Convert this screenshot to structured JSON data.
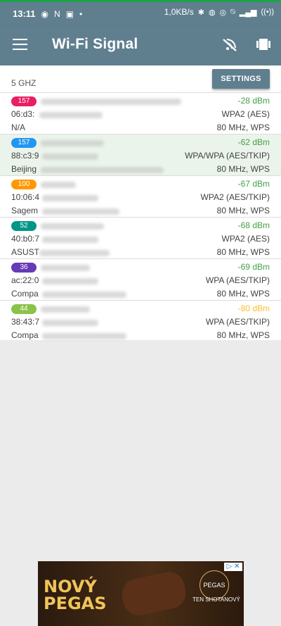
{
  "status_bar": {
    "time": "13:11",
    "net_speed": "1,0KB/s"
  },
  "app_bar": {
    "title": "Wi-Fi Signal"
  },
  "section": {
    "label": "5 GHZ",
    "settings_label": "SETTINGS"
  },
  "networks": [
    {
      "channel": "157",
      "channel_color": "#e91e63",
      "mac": "06:d3:",
      "vendor": "N/A",
      "dbm": "-28 dBm",
      "security": "WPA2 (AES)",
      "band": "80 MHz, WPS",
      "dbm_color": "#43a047"
    },
    {
      "channel": "157",
      "channel_color": "#2196f3",
      "mac": "88:c3:9",
      "vendor": "Beijing",
      "dbm": "-62 dBm",
      "security": "WPA/WPA (AES/TKIP)",
      "band": "80 MHz, WPS",
      "dbm_color": "#43a047"
    },
    {
      "channel": "100",
      "channel_color": "#ff9800",
      "mac": "10:06:4",
      "vendor": "Sagem",
      "dbm": "-67 dBm",
      "security": "WPA2 (AES/TKIP)",
      "band": "80 MHz, WPS",
      "dbm_color": "#43a047"
    },
    {
      "channel": "52",
      "channel_color": "#009688",
      "mac": "40:b0:7",
      "vendor": "ASUST",
      "dbm": "-68 dBm",
      "security": "WPA2 (AES)",
      "band": "80 MHz, WPS",
      "dbm_color": "#43a047"
    },
    {
      "channel": "36",
      "channel_color": "#673ab7",
      "mac": "ac:22:0",
      "vendor": "Compa",
      "dbm": "-69 dBm",
      "security": "WPA (AES/TKIP)",
      "band": "80 MHz, WPS",
      "dbm_color": "#43a047"
    },
    {
      "channel": "44",
      "channel_color": "#8bc34a",
      "mac": "38:43:7",
      "vendor": "Compa",
      "dbm": "-80 dBm",
      "security": "WPA (AES/TKIP)",
      "band": "80 MHz, WPS",
      "dbm_color": "#fbc02d"
    }
  ],
  "ad": {
    "headline_1": "NOVÝ",
    "headline_2": "PEGAS",
    "brand": "PEGAS",
    "tagline": "TEN SHOTANOVÝ",
    "close_label": "▷ ✕"
  }
}
